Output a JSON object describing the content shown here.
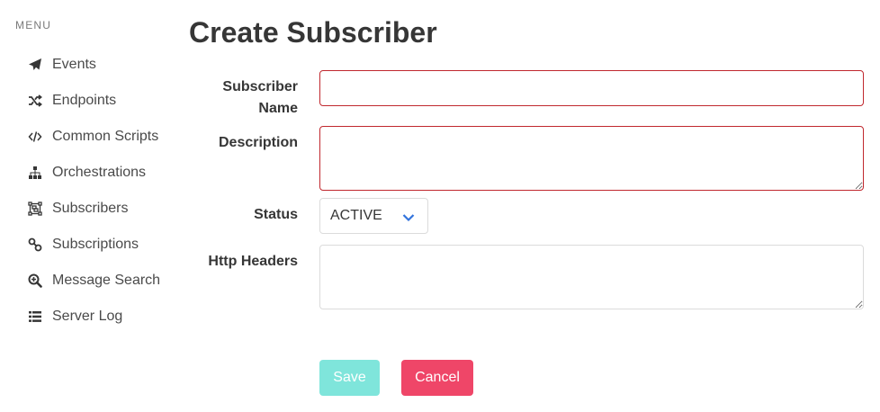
{
  "sidebar": {
    "menu_label": "MENU",
    "items": [
      {
        "label": "Events",
        "icon": "paper-plane-icon"
      },
      {
        "label": "Endpoints",
        "icon": "random-icon"
      },
      {
        "label": "Common Scripts",
        "icon": "code-icon"
      },
      {
        "label": "Orchestrations",
        "icon": "sitemap-icon"
      },
      {
        "label": "Subscribers",
        "icon": "object-group-icon"
      },
      {
        "label": "Subscriptions",
        "icon": "link-icon"
      },
      {
        "label": "Message Search",
        "icon": "search-plus-icon"
      },
      {
        "label": "Server Log",
        "icon": "list-icon"
      }
    ]
  },
  "page": {
    "title": "Create Subscriber"
  },
  "form": {
    "subscriber_name_label_line1": "Subscriber",
    "subscriber_name_label_line2": "Name",
    "subscriber_name_value": "",
    "description_label": "Description",
    "description_value": "",
    "status_label": "Status",
    "status_value": "ACTIVE",
    "http_headers_label": "Http Headers",
    "http_headers_value": "",
    "save_label": "Save",
    "cancel_label": "Cancel"
  },
  "colors": {
    "danger_border": "#c0282e",
    "save_button": "#7fe5db",
    "cancel_button": "#ef4668",
    "chevron": "#3273dc"
  }
}
